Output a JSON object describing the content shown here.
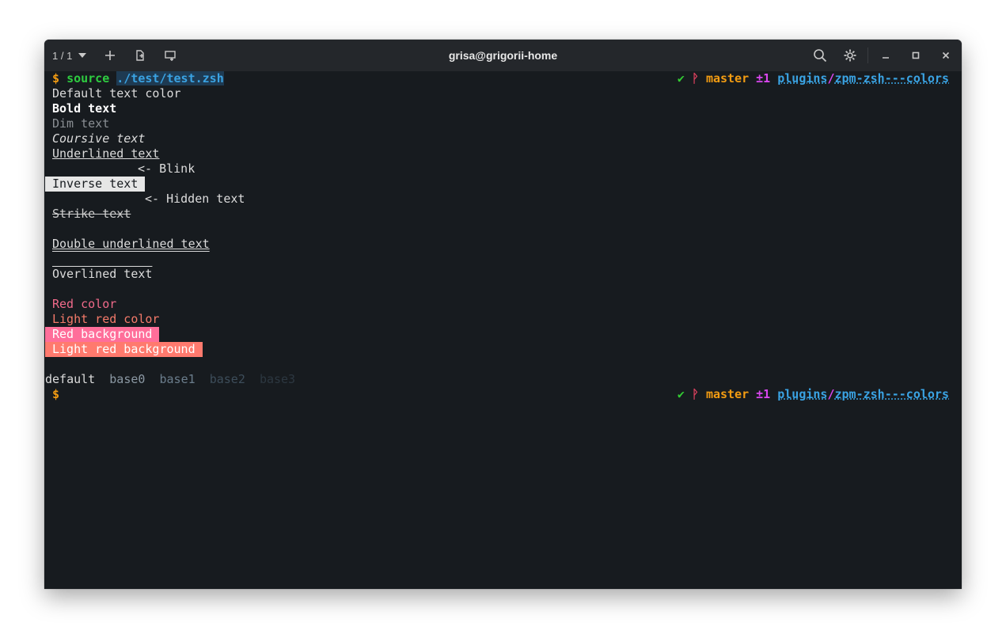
{
  "window": {
    "title": "grisa@grigorii-home",
    "tab_counter": "1 / 1",
    "icons": [
      "plus-icon",
      "new-tab-icon",
      "split-icon",
      "search-icon",
      "gear-icon",
      "minimize-icon",
      "maximize-icon",
      "close-icon"
    ]
  },
  "terminal": {
    "prompt_symbol": "$",
    "command": "source",
    "command_arg": "./test/test.zsh",
    "lines": {
      "default": "Default text color",
      "bold": "Bold text",
      "dim": "Dim text",
      "italic": "Coursive text",
      "underline": "Underlined text",
      "blink": "<- Blink",
      "inverse": "Inverse text",
      "hidden": "<- Hidden text",
      "strike": "Strike text",
      "double_underline": "Double underlined text",
      "overline": "Overlined text",
      "red": "Red color",
      "light_red": "Light red color",
      "red_bg": "Red background",
      "light_red_bg": "Light red background"
    },
    "base_row": {
      "default": "default",
      "base0": "base0",
      "base1": "base1",
      "base2": "base2",
      "base3": "base3"
    },
    "right_prompt": {
      "check": "✔",
      "branch_icon": "ᚹ",
      "branch": "master",
      "modified": "±1",
      "dir_parent": "plugins",
      "dir_sep": "/",
      "dir_current": "zpm-zsh---colors"
    }
  },
  "colors": {
    "terminal_bg": "#171b1f",
    "titlebar_bg": "#24272b",
    "prompt": "#f39c12",
    "command": "#2ecc40",
    "path": "#3aa3e3",
    "red": "#f06a8a",
    "light_red": "#f47a6a"
  }
}
